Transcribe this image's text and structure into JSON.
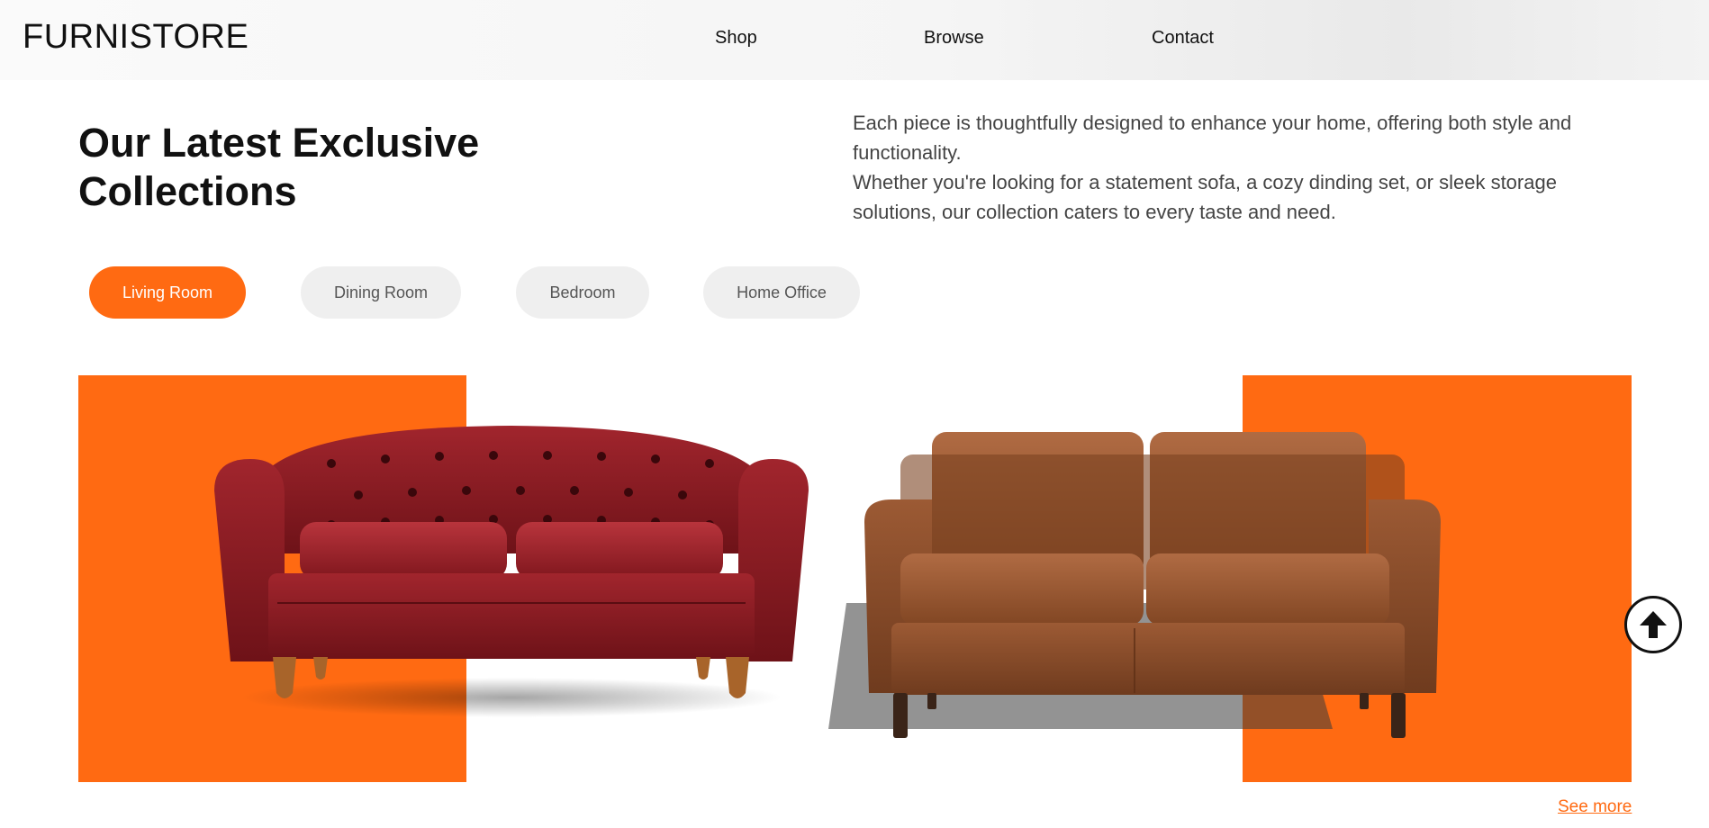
{
  "header": {
    "brand": "FURNISTORE",
    "nav": [
      {
        "label": "Shop"
      },
      {
        "label": "Browse"
      },
      {
        "label": "Contact"
      }
    ]
  },
  "hero": {
    "title": "Our Latest Exclusive Collections",
    "intro_1": "Each piece is thoughtfully designed to enhance your home, offering both style and functionality.",
    "intro_2": "Whether you're looking for a statement sofa, a cozy dinding set, or sleek storage solutions, our collection caters to every taste and need."
  },
  "tabs": [
    {
      "label": "Living Room",
      "active": true
    },
    {
      "label": "Dining Room",
      "active": false
    },
    {
      "label": "Bedroom",
      "active": false
    },
    {
      "label": "Home Office",
      "active": false
    }
  ],
  "products": {
    "see_more": "See more"
  },
  "icons": {
    "scroll_top": "arrow-up-circle-icon"
  },
  "colors": {
    "accent": "#ff6a12",
    "tab_inactive_bg": "#efefef",
    "red_leather": "#8e1b22",
    "brown_leather": "#8a4a28"
  }
}
